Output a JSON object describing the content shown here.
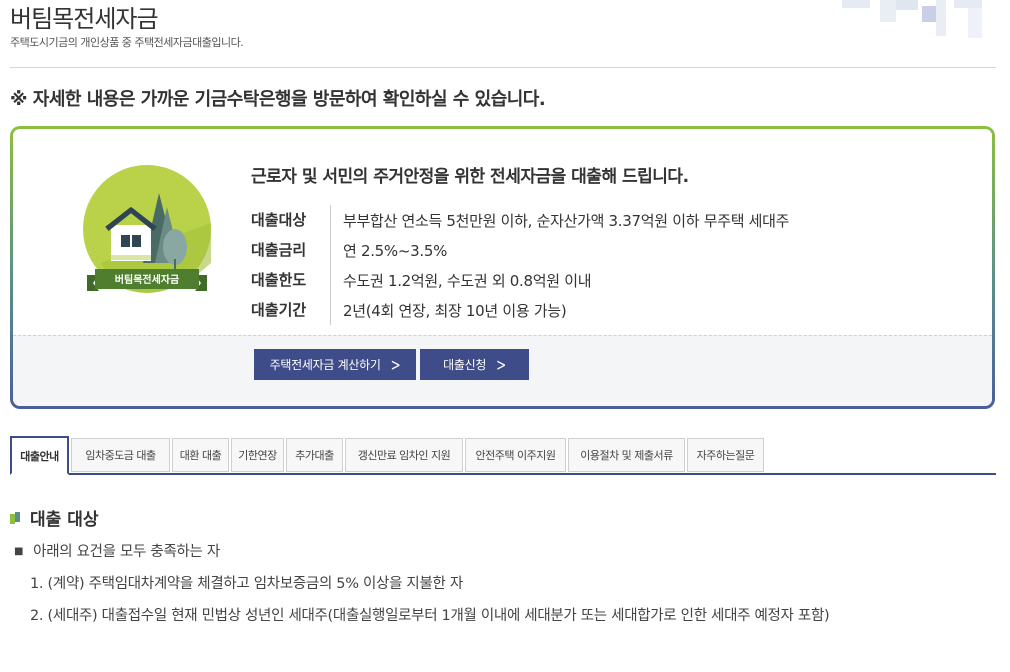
{
  "header": {
    "title": "버팀목전세자금",
    "subtitle": "주택도시기금의 개인상품 중 주택전세자금대출입니다."
  },
  "notice": "※ 자세한 내용은 가까운 기금수탁은행을 방문하여 확인하실 수 있습니다.",
  "info": {
    "emblem_label": "버팀목전세자금",
    "headline": "근로자 및 서민의 주거안정을 위한 전세자금을 대출해 드립니다.",
    "rows": [
      {
        "label": "대출대상",
        "value": "부부합산 연소득 5천만원 이하, 순자산가액 3.37억원 이하 무주택 세대주"
      },
      {
        "label": "대출금리",
        "value": "연 2.5%~3.5%"
      },
      {
        "label": "대출한도",
        "value": "수도권 1.2억원, 수도권 외 0.8억원 이내"
      },
      {
        "label": "대출기간",
        "value": "2년(4회 연장, 최장 10년 이용 가능)"
      }
    ],
    "buttons": {
      "calc": "주택전세자금 계산하기",
      "apply": "대출신청"
    }
  },
  "tabs": [
    {
      "label": "대출안내",
      "active": true
    },
    {
      "label": "임차중도금 대출"
    },
    {
      "label": "대환 대출"
    },
    {
      "label": "기한연장"
    },
    {
      "label": "추가대출"
    },
    {
      "label": "갱신만료 임차인 지원"
    },
    {
      "label": "안전주택 이주지원"
    },
    {
      "label": "이용절차 및 제출서류"
    },
    {
      "label": "자주하는질문"
    }
  ],
  "section": {
    "title": "대출 대상",
    "intro": "아래의 요건을 모두 충족하는 자",
    "items": [
      "1. (계약) 주택임대차계약을 체결하고 임차보증금의 5% 이상을 지불한 자",
      "2. (세대주) 대출접수일 현재 민법상 성년인 세대주(대출실행일로부터 1개월 이내에 세대분가 또는 세대합가로 인한 세대주 예정자 포함)"
    ]
  },
  "colors": {
    "navy": "#3f4c8a",
    "green": "#8dbf3e",
    "emblem_green": "#b9d24a"
  }
}
